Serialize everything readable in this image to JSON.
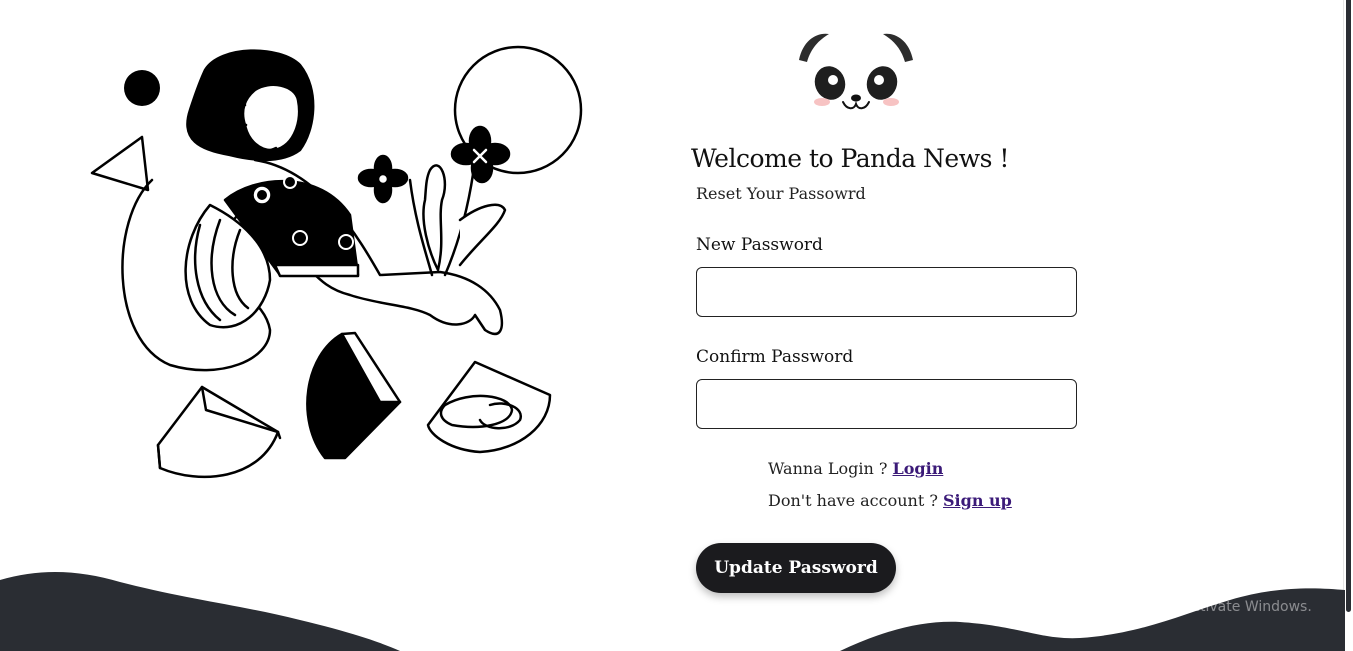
{
  "branding": {
    "logo_icon": "panda-icon"
  },
  "hero": {
    "illustration_icon": "woman-with-flowers-illustration"
  },
  "form": {
    "title": "Welcome to Panda News !",
    "subtitle": "Reset Your Passowrd",
    "new_password_label": "New Password",
    "new_password_value": "",
    "confirm_password_label": "Confirm Password",
    "confirm_password_value": "",
    "login_prompt": "Wanna Login ? ",
    "login_link": "Login",
    "signup_prompt": "Don't have account ? ",
    "signup_link": "Sign up",
    "submit_label": "Update Password"
  },
  "watermark": {
    "line1": "Activate Windows",
    "line2": "Go to Settings to activate Windows."
  },
  "colors": {
    "wave": "#2a2d33",
    "button_bg": "#1b1b1e",
    "link": "#3b1a78",
    "panda_blush": "#f7c3c3"
  }
}
